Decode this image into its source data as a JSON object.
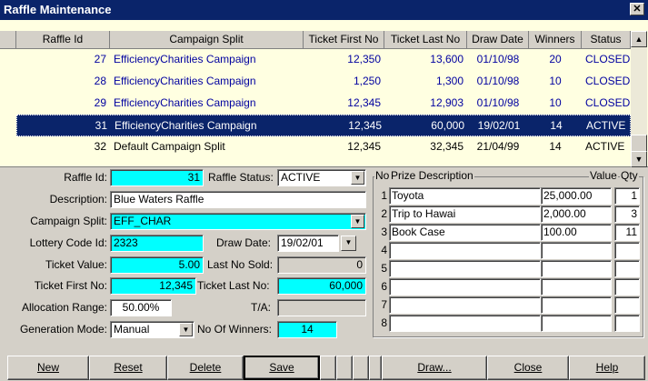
{
  "window": {
    "title": "Raffle Maintenance",
    "close_glyph": "✕"
  },
  "grid": {
    "headers": [
      "Raffle Id",
      "Campaign Split",
      "Ticket First No",
      "Ticket Last No",
      "Draw Date",
      "Winners",
      "Status"
    ],
    "rows": [
      {
        "id": "27",
        "campaign": "EfficiencyCharities Campaign",
        "first": "12,350",
        "last": "13,600",
        "date": "01/10/98",
        "winners": "20",
        "status": "CLOSED"
      },
      {
        "id": "28",
        "campaign": "EfficiencyCharities Campaign",
        "first": "1,250",
        "last": "1,300",
        "date": "01/10/98",
        "winners": "10",
        "status": "CLOSED"
      },
      {
        "id": "29",
        "campaign": "EfficiencyCharities Campaign",
        "first": "12,345",
        "last": "12,903",
        "date": "01/10/98",
        "winners": "10",
        "status": "CLOSED"
      },
      {
        "id": "31",
        "campaign": "EfficiencyCharities Campaign",
        "first": "12,345",
        "last": "60,000",
        "date": "19/02/01",
        "winners": "14",
        "status": "ACTIVE"
      },
      {
        "id": "32",
        "campaign": "Default Campaign Split",
        "first": "12,345",
        "last": "32,345",
        "date": "21/04/99",
        "winners": "14",
        "status": "ACTIVE"
      }
    ],
    "selected_row": 3,
    "scroll_up": "▲",
    "scroll_down": "▼"
  },
  "form": {
    "raffle_id_label": "Raffle Id:",
    "raffle_id": "31",
    "raffle_status_label": "Raffle Status:",
    "raffle_status": "ACTIVE",
    "description_label": "Description:",
    "description": "Blue Waters Raffle",
    "campaign_split_label": "Campaign Split:",
    "campaign_split": "EFF_CHAR",
    "lottery_code_label": "Lottery Code Id:",
    "lottery_code": "2323",
    "draw_date_label": "Draw Date:",
    "draw_date": "19/02/01",
    "ticket_value_label": "Ticket Value:",
    "ticket_value": "5.00",
    "last_no_sold_label": "Last No Sold:",
    "last_no_sold": "0",
    "ticket_first_label": "Ticket First No:",
    "ticket_first": "12,345",
    "ticket_last_label": "Ticket Last No:",
    "ticket_last": "60,000",
    "allocation_label": "Allocation Range:",
    "allocation": "50.00%",
    "ta_label": "T/A:",
    "ta": "",
    "generation_label": "Generation Mode:",
    "generation": "Manual",
    "winners_label": "No Of Winners:",
    "winners": "14",
    "dropdown_glyph": "▼"
  },
  "prizes": {
    "header_no": "No",
    "header_desc": "Prize Description",
    "header_value": "Value",
    "header_qty": "Qty",
    "rows": [
      {
        "no": "1",
        "desc": "Toyota",
        "value": "25,000.00",
        "qty": "1"
      },
      {
        "no": "2",
        "desc": "Trip to Hawai",
        "value": "2,000.00",
        "qty": "3"
      },
      {
        "no": "3",
        "desc": "Book Case",
        "value": "100.00",
        "qty": "11"
      },
      {
        "no": "4",
        "desc": "",
        "value": "",
        "qty": ""
      },
      {
        "no": "5",
        "desc": "",
        "value": "",
        "qty": ""
      },
      {
        "no": "6",
        "desc": "",
        "value": "",
        "qty": ""
      },
      {
        "no": "7",
        "desc": "",
        "value": "",
        "qty": ""
      },
      {
        "no": "8",
        "desc": "",
        "value": "",
        "qty": ""
      }
    ]
  },
  "buttons": {
    "new": "New",
    "reset": "Reset",
    "delete": "Delete",
    "save": "Save",
    "draw": "Draw...",
    "close": "Close",
    "help": "Help"
  }
}
